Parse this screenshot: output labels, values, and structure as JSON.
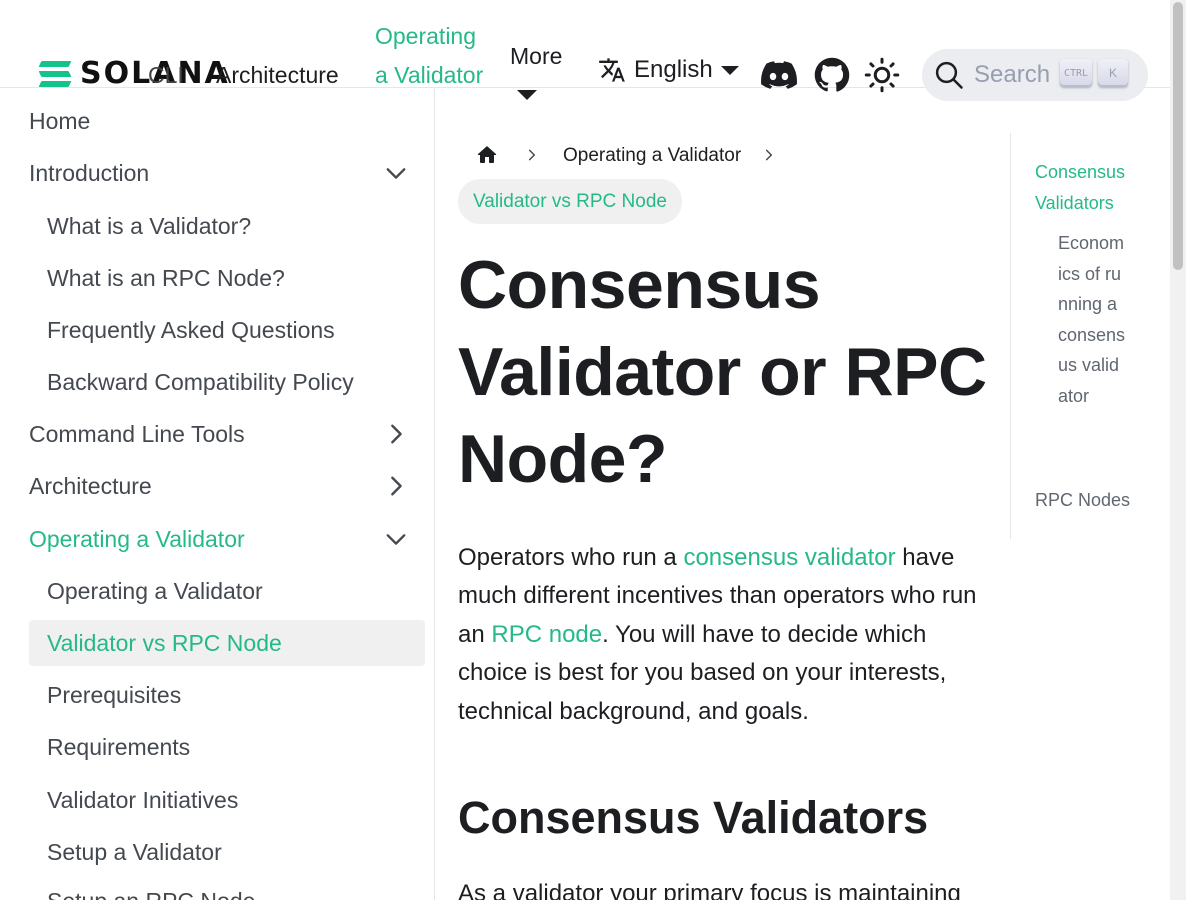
{
  "brand": {
    "name": "SOLANA",
    "accent": "#25b98a"
  },
  "navbar": {
    "cli_label": "CLI",
    "architecture_label": "Architecture",
    "operating_label": "Operating a Validator",
    "more_label": "More",
    "language_label": "English",
    "search_placeholder": "Search",
    "kbd_ctrl": "CTRL",
    "kbd_k": "K",
    "icons": [
      "translate-icon",
      "discord-icon",
      "github-icon",
      "theme-toggle-icon",
      "search-icon"
    ]
  },
  "sidebar": {
    "items": [
      {
        "label": "Home"
      },
      {
        "label": "Introduction"
      },
      {
        "label": "What is a Validator?"
      },
      {
        "label": "What is an RPC Node?"
      },
      {
        "label": "Frequently Asked Questions"
      },
      {
        "label": "Backward Compatibility Policy"
      },
      {
        "label": "Command Line Tools"
      },
      {
        "label": "Architecture"
      },
      {
        "label": "Operating a Validator"
      },
      {
        "label": "Operating a Validator"
      },
      {
        "label": "Validator vs RPC Node"
      },
      {
        "label": "Prerequisites"
      },
      {
        "label": "Requirements"
      },
      {
        "label": "Validator Initiatives"
      },
      {
        "label": "Setup a Validator"
      },
      {
        "label": "Setup an RPC Node"
      }
    ]
  },
  "breadcrumb": {
    "items": [
      "Operating a Validator",
      "Validator vs RPC Node"
    ]
  },
  "article": {
    "title": "Consensus Validator or RPC Node?",
    "intro_1": "Operators who run a ",
    "intro_link_1": "consensus validator",
    "intro_2": " have much different incentives than operators who run an ",
    "intro_link_2": "RPC node",
    "intro_3": ". You will have to decide which choice is best for you based on your interests, technical background, and goals.",
    "section_heading": "Consensus Validators",
    "section_text": "As a validator your primary focus is maintaining"
  },
  "toc": {
    "items": [
      "Consensus Validators",
      "Economics of running a consensus validator",
      "RPC Nodes"
    ]
  }
}
